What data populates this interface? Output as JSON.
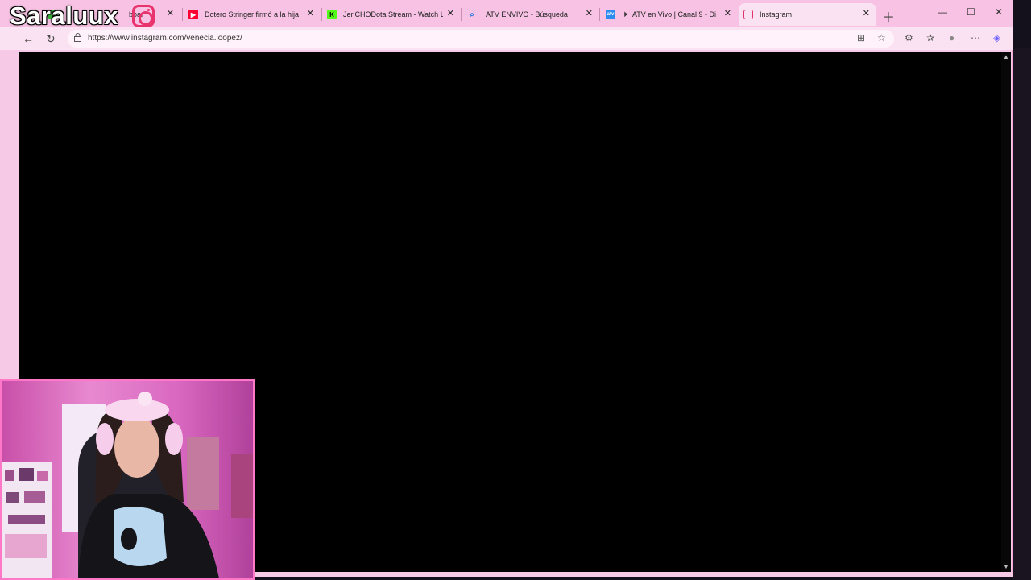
{
  "browser": {
    "tabs": [
      {
        "label": "boar",
        "icon": "tab-favicon",
        "color": "#38b43a",
        "active": false
      },
      {
        "label": "Dotero Stringer firmó a la hija",
        "icon": "youtube-icon",
        "color": "#ff0033",
        "active": false
      },
      {
        "label": "JeriCHODota Stream - Watch Li",
        "icon": "kick-icon",
        "color": "#53fc18",
        "active": false
      },
      {
        "label": "ATV ENVIVO - Búsqueda",
        "icon": "search-icon",
        "color": "#1a73e8",
        "active": false
      },
      {
        "label": "ATV en Vivo | Canal 9 - Di",
        "icon": "atv-icon",
        "color": "#2d8cf0",
        "active": false
      },
      {
        "label": "Instagram",
        "icon": "instagram-icon",
        "color": "#e1306c",
        "active": true
      }
    ],
    "url": "https://www.instagram.com/venecia.loopez/"
  },
  "overlay": {
    "channel_name": "Saraluux"
  },
  "colors": {
    "chrome_pink": "#f7c2e3",
    "toolbar_pink": "#fbe2f2",
    "content_bg": "#000000",
    "webcam_border": "#ff78c8"
  }
}
